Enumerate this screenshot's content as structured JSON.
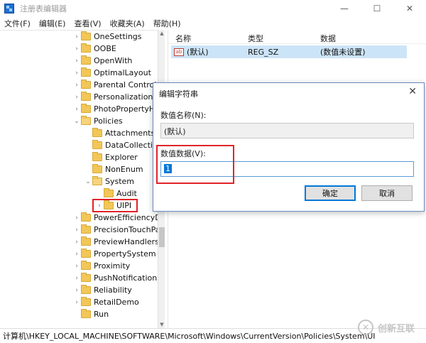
{
  "window": {
    "title": "注册表编辑器",
    "controls": [
      "—",
      "☐",
      "✕"
    ]
  },
  "menu": [
    "文件(F)",
    "编辑(E)",
    "查看(V)",
    "收藏夹(A)",
    "帮助(H)"
  ],
  "tree": {
    "items": [
      {
        "label": "OneSettings",
        "arrow": "›",
        "level": 0
      },
      {
        "label": "OOBE",
        "arrow": "›",
        "level": 0
      },
      {
        "label": "OpenWith",
        "arrow": "›",
        "level": 0
      },
      {
        "label": "OptimalLayout",
        "arrow": "›",
        "level": 0
      },
      {
        "label": "Parental Controls",
        "arrow": "›",
        "level": 0
      },
      {
        "label": "Personalization",
        "arrow": "›",
        "level": 0
      },
      {
        "label": "PhotoPropertyH",
        "arrow": "›",
        "level": 0
      },
      {
        "label": "Policies",
        "arrow": "⌄",
        "level": 0
      },
      {
        "label": "Attachments",
        "arrow": "",
        "level": 1
      },
      {
        "label": "DataCollection",
        "arrow": "",
        "level": 1
      },
      {
        "label": "Explorer",
        "arrow": "",
        "level": 1
      },
      {
        "label": "NonEnum",
        "arrow": "",
        "level": 1
      },
      {
        "label": "System",
        "arrow": "⌄",
        "level": 1
      },
      {
        "label": "Audit",
        "arrow": "",
        "level": 2
      },
      {
        "label": "UIPI",
        "arrow": "›",
        "level": 2
      },
      {
        "label": "PowerEfficiencyDi",
        "arrow": "›",
        "level": 0
      },
      {
        "label": "PrecisionTouchPa",
        "arrow": "›",
        "level": 0
      },
      {
        "label": "PreviewHandlers",
        "arrow": "›",
        "level": 0
      },
      {
        "label": "PropertySystem",
        "arrow": "›",
        "level": 0
      },
      {
        "label": "Proximity",
        "arrow": "›",
        "level": 0
      },
      {
        "label": "PushNotifications",
        "arrow": "›",
        "level": 0
      },
      {
        "label": "Reliability",
        "arrow": "›",
        "level": 0
      },
      {
        "label": "RetailDemo",
        "arrow": "›",
        "level": 0
      },
      {
        "label": "Run",
        "arrow": "",
        "level": 0
      }
    ]
  },
  "values_pane": {
    "columns": [
      "名称",
      "类型",
      "数据"
    ],
    "rows": [
      {
        "icon": "ab",
        "name": "(默认)",
        "type": "REG_SZ",
        "data": "(数值未设置)"
      }
    ]
  },
  "statusbar": {
    "path": "计算机\\HKEY_LOCAL_MACHINE\\SOFTWARE\\Microsoft\\Windows\\CurrentVersion\\Policies\\System\\UI"
  },
  "dialog": {
    "title": "编辑字符串",
    "close": "✕",
    "name_label": "数值名称(N):",
    "name_value": "(默认)",
    "data_label": "数值数据(V):",
    "data_value": "1",
    "ok": "确定",
    "cancel": "取消"
  },
  "watermark": {
    "text": "创新互联"
  },
  "colors": {
    "highlight_red": "#e0242a",
    "selection_blue": "#cce4f7",
    "folder": "#f2c757",
    "accent": "#0078d7"
  }
}
